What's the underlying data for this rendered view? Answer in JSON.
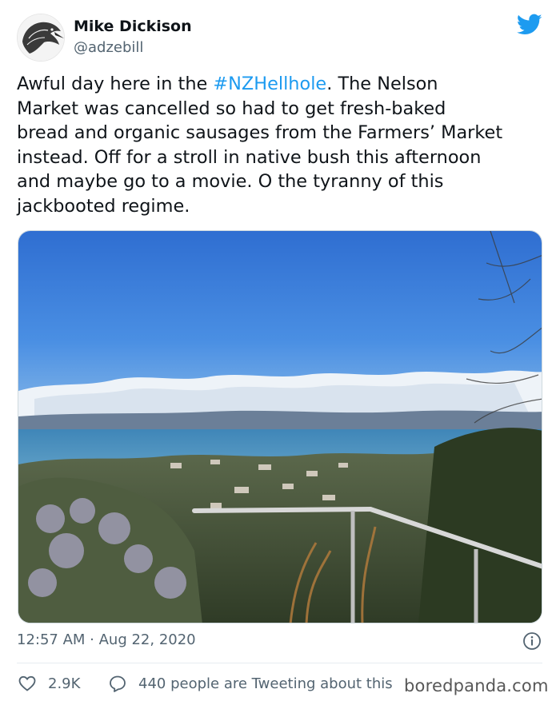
{
  "author": {
    "display_name": "Mike Dickison",
    "handle": "@adzebill"
  },
  "tweet": {
    "line1_before": "Awful day here in the ",
    "hashtag": "#NZHellhole",
    "line1_after": ". The Nelson",
    "line2": "Market was cancelled so had to get fresh-baked",
    "line3": "bread and organic sausages from the Farmers’ Market",
    "line4": "instead. Off for a stroll in native bush this afternoon",
    "line5": "and maybe go to a movie. O the tyranny of this",
    "line6": "jackbooted regime."
  },
  "meta": {
    "timestamp": "12:57 AM · Aug 22, 2020"
  },
  "actions": {
    "like_count": "2.9K",
    "reply_text": "440 people are Tweeting about this"
  },
  "watermark": "boredpanda.com",
  "icons": {
    "platform": "twitter-bird-icon",
    "info": "info-icon",
    "like": "heart-icon",
    "reply": "speech-bubble-icon"
  },
  "colors": {
    "accent": "#1d9bf0",
    "text": "#0f1419",
    "secondary": "#536471"
  }
}
